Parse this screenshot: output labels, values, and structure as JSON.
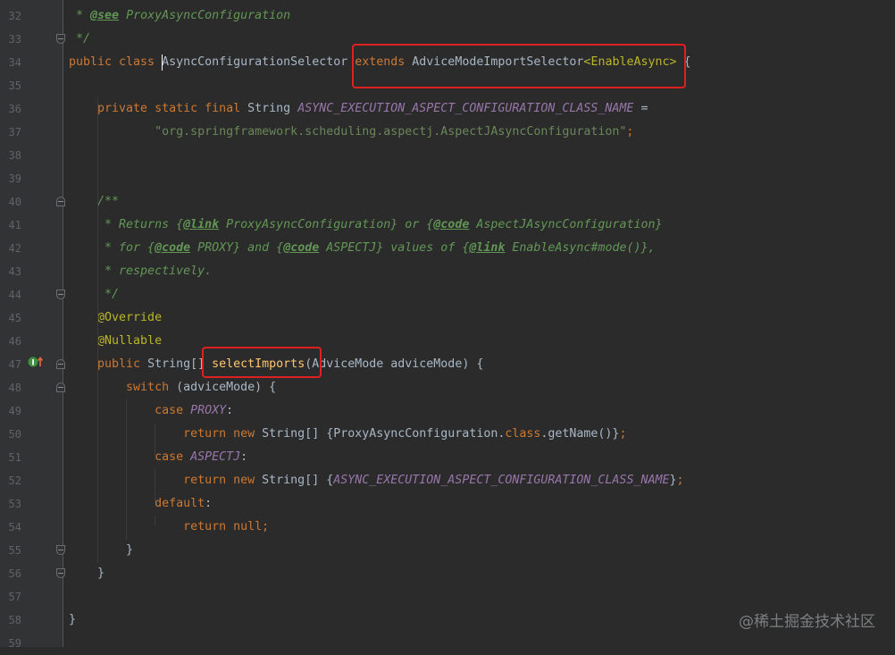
{
  "editor": {
    "lines": [
      {
        "n": "32",
        "tokens": [
          [
            "cm",
            " * "
          ],
          [
            "tag",
            "@see"
          ],
          [
            "cm",
            " ProxyAsyncConfiguration"
          ]
        ]
      },
      {
        "n": "33",
        "tokens": [
          [
            "cm",
            " */"
          ]
        ]
      },
      {
        "n": "34",
        "tokens": [
          [
            "kw",
            "public class "
          ],
          [
            "plain",
            "AsyncConfigurationSelector "
          ],
          [
            "kw",
            "extends "
          ],
          [
            "plain",
            "AdviceModeImportSelector"
          ],
          [
            "tp",
            "<"
          ],
          [
            "tp",
            "EnableAsync"
          ],
          [
            "tp",
            ">"
          ],
          [
            "plain",
            " {"
          ]
        ]
      },
      {
        "n": "35",
        "tokens": []
      },
      {
        "n": "36",
        "tokens": [
          [
            "kw",
            "    private static final "
          ],
          [
            "plain",
            "String "
          ],
          [
            "cst",
            "ASYNC_EXECUTION_ASPECT_CONFIGURATION_CLASS_NAME"
          ],
          [
            "plain",
            " ="
          ]
        ]
      },
      {
        "n": "37",
        "tokens": [
          [
            "str",
            "            \"org.springframework.scheduling.aspectj.AspectJAsyncConfiguration\""
          ],
          [
            "kw",
            ";"
          ]
        ]
      },
      {
        "n": "38",
        "tokens": []
      },
      {
        "n": "39",
        "tokens": []
      },
      {
        "n": "40",
        "tokens": [
          [
            "cm",
            "    /**"
          ]
        ]
      },
      {
        "n": "41",
        "tokens": [
          [
            "cm",
            "     * Returns {"
          ],
          [
            "tag",
            "@link"
          ],
          [
            "cm",
            " ProxyAsyncConfiguration} or {"
          ],
          [
            "tag",
            "@code"
          ],
          [
            "cm",
            " AspectJAsyncConfiguration}"
          ]
        ]
      },
      {
        "n": "42",
        "tokens": [
          [
            "cm",
            "     * for {"
          ],
          [
            "tag",
            "@code"
          ],
          [
            "cm",
            " PROXY} and {"
          ],
          [
            "tag",
            "@code"
          ],
          [
            "cm",
            " ASPECTJ} values of {"
          ],
          [
            "tag",
            "@link"
          ],
          [
            "cm",
            " EnableAsync#mode()},"
          ]
        ]
      },
      {
        "n": "43",
        "tokens": [
          [
            "cm",
            "     * respectively."
          ]
        ]
      },
      {
        "n": "44",
        "tokens": [
          [
            "cm",
            "     */"
          ]
        ]
      },
      {
        "n": "45",
        "tokens": [
          [
            "ann",
            "    @Override"
          ]
        ]
      },
      {
        "n": "46",
        "tokens": [
          [
            "ann",
            "    @Nullable"
          ]
        ]
      },
      {
        "n": "47",
        "tokens": [
          [
            "kw",
            "    public "
          ],
          [
            "plain",
            "String[] "
          ],
          [
            "fn",
            "selectImports"
          ],
          [
            "plain",
            "(AdviceMode adviceMode) {"
          ]
        ]
      },
      {
        "n": "48",
        "tokens": [
          [
            "kw",
            "        switch "
          ],
          [
            "plain",
            "(adviceMode) {"
          ]
        ]
      },
      {
        "n": "49",
        "tokens": [
          [
            "kw",
            "            case "
          ],
          [
            "cst",
            "PROXY"
          ],
          [
            "plain",
            ":"
          ]
        ]
      },
      {
        "n": "50",
        "tokens": [
          [
            "kw",
            "                return new "
          ],
          [
            "plain",
            "String[] {ProxyAsyncConfiguration."
          ],
          [
            "kw",
            "class"
          ],
          [
            "plain",
            ".getName()}"
          ],
          [
            "kw",
            ";"
          ]
        ]
      },
      {
        "n": "51",
        "tokens": [
          [
            "kw",
            "            case "
          ],
          [
            "cst",
            "ASPECTJ"
          ],
          [
            "plain",
            ":"
          ]
        ]
      },
      {
        "n": "52",
        "tokens": [
          [
            "kw",
            "                return new "
          ],
          [
            "plain",
            "String[] {"
          ],
          [
            "cst",
            "ASYNC_EXECUTION_ASPECT_CONFIGURATION_CLASS_NAME"
          ],
          [
            "plain",
            "}"
          ],
          [
            "kw",
            ";"
          ]
        ]
      },
      {
        "n": "53",
        "tokens": [
          [
            "kw",
            "            default"
          ],
          [
            "plain",
            ":"
          ]
        ]
      },
      {
        "n": "54",
        "tokens": [
          [
            "kw",
            "                return null;"
          ]
        ]
      },
      {
        "n": "55",
        "tokens": [
          [
            "plain",
            "        }"
          ]
        ]
      },
      {
        "n": "56",
        "tokens": [
          [
            "plain",
            "    }"
          ]
        ]
      },
      {
        "n": "57",
        "tokens": []
      },
      {
        "n": "58",
        "tokens": [
          [
            "plain",
            "}"
          ]
        ]
      },
      {
        "n": "59",
        "tokens": []
      }
    ]
  },
  "watermark": "@稀土掘金技术社区",
  "colors": {
    "background": "#2b2b2b",
    "highlight_box": "#e02020",
    "keyword": "#cc7832",
    "comment": "#629755",
    "string": "#6a8759",
    "constant": "#9876aa",
    "annotation": "#bbb529",
    "method": "#ffc66d"
  }
}
